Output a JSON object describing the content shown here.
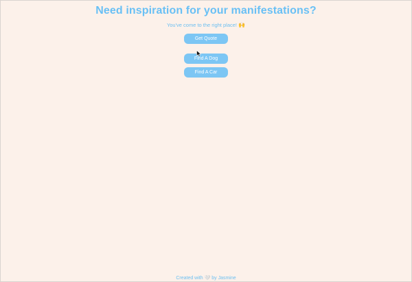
{
  "header": {
    "title": "Need inspiration for your manifestations?",
    "subtitle": "You've come to the right place!",
    "subtitle_emoji": "🙌"
  },
  "buttons": {
    "get_quote": "Get Quote",
    "find_dog": "Find A Dog",
    "find_car": "Find A Car"
  },
  "footer": {
    "prefix": "Created with",
    "heart": "🤍",
    "suffix": "by Jasmine"
  },
  "colors": {
    "background": "#fcf1ea",
    "accent": "#69c0f5",
    "button": "#7cc6f4",
    "button_text": "#ffffff"
  },
  "icons": {
    "cursor": "mouse-pointer-icon",
    "heart": "heart-icon"
  }
}
